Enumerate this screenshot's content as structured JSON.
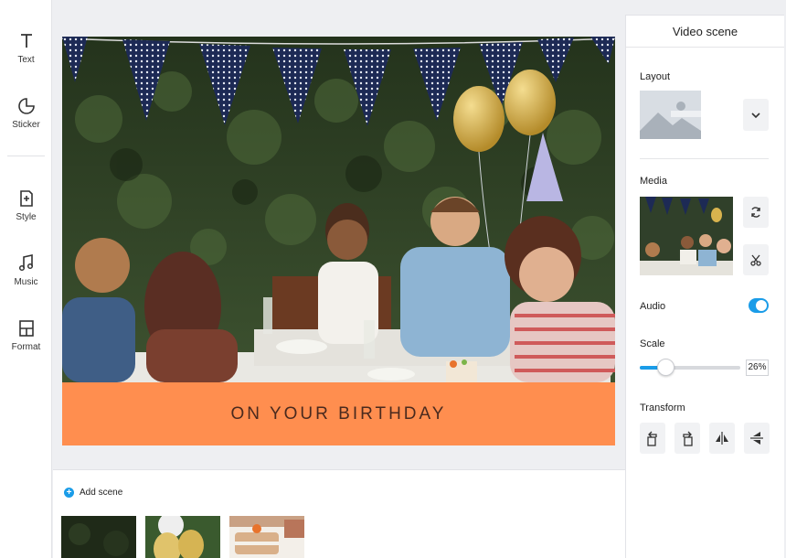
{
  "tools": [
    {
      "label": "Text",
      "icon": "text-icon"
    },
    {
      "label": "Sticker",
      "icon": "sticker-icon"
    },
    {
      "label": "Style",
      "icon": "style-icon"
    },
    {
      "label": "Music",
      "icon": "music-icon"
    },
    {
      "label": "Format",
      "icon": "format-icon"
    }
  ],
  "canvas": {
    "caption": "ON YOUR BIRTHDAY",
    "caption_bg": "#ff8e4f",
    "caption_color": "#4a2a1e"
  },
  "scenes": {
    "add_label": "Add scene",
    "accent": "#1a9ce8"
  },
  "panel": {
    "title": "Video scene",
    "layout_label": "Layout",
    "media_label": "Media",
    "audio_label": "Audio",
    "audio_on": true,
    "scale_label": "Scale",
    "scale_value": "26%",
    "scale_fraction": 0.26,
    "transform_label": "Transform",
    "toggle_color": "#1a9ce8"
  }
}
